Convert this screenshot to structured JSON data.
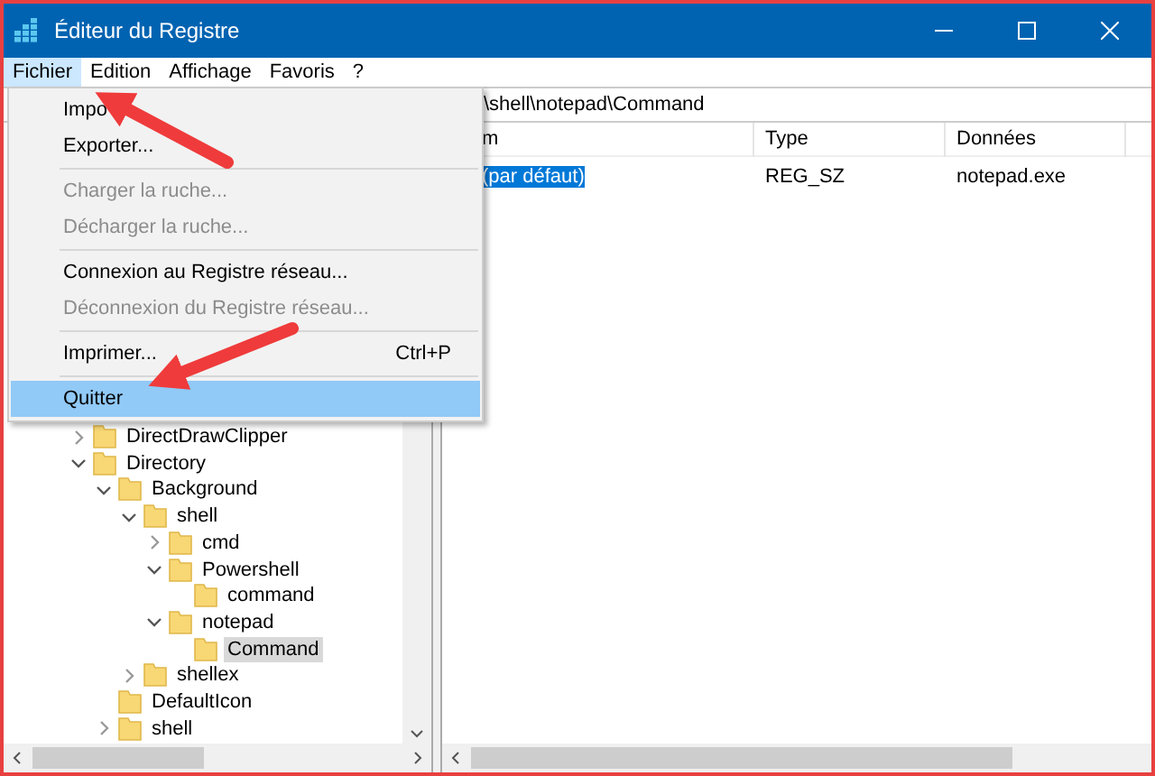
{
  "window": {
    "title": "Éditeur du Registre"
  },
  "menu_bar": [
    {
      "label": "Fichier",
      "selected": true
    },
    {
      "label": "Edition",
      "selected": false
    },
    {
      "label": "Affichage",
      "selected": false
    },
    {
      "label": "Favoris",
      "selected": false
    },
    {
      "label": "?",
      "selected": false
    }
  ],
  "file_menu": [
    {
      "kind": "item",
      "label": "Impo",
      "disabled": false,
      "selected": false
    },
    {
      "kind": "item",
      "label": "Exporter...",
      "disabled": false,
      "selected": false
    },
    {
      "kind": "separator"
    },
    {
      "kind": "item",
      "label": "Charger la ruche...",
      "disabled": true,
      "selected": false
    },
    {
      "kind": "item",
      "label": "Décharger la ruche...",
      "disabled": true,
      "selected": false
    },
    {
      "kind": "separator"
    },
    {
      "kind": "item",
      "label": "Connexion au Registre réseau...",
      "disabled": false,
      "selected": false
    },
    {
      "kind": "item",
      "label": "Déconnexion du Registre réseau...",
      "disabled": true,
      "selected": false
    },
    {
      "kind": "separator"
    },
    {
      "kind": "item",
      "label": "Imprimer...",
      "shortcut": "Ctrl+P",
      "disabled": false,
      "selected": false
    },
    {
      "kind": "separator"
    },
    {
      "kind": "item",
      "label": "Quitter",
      "disabled": false,
      "selected": true
    }
  ],
  "address_bar": {
    "value": "\\shell\\notepad\\Command"
  },
  "tree": [
    {
      "label": "DirectDrawClipper",
      "expanded": false,
      "selected": false
    },
    {
      "label": "Directory",
      "expanded": true,
      "selected": false,
      "children": [
        {
          "label": "Background",
          "expanded": true,
          "selected": false,
          "children": [
            {
              "label": "shell",
              "expanded": true,
              "selected": false,
              "children": [
                {
                  "label": "cmd",
                  "expanded": false,
                  "selected": false
                },
                {
                  "label": "Powershell",
                  "expanded": true,
                  "selected": false,
                  "children": [
                    {
                      "label": "command",
                      "selected": false
                    }
                  ]
                },
                {
                  "label": "notepad",
                  "expanded": true,
                  "selected": false,
                  "children": [
                    {
                      "label": "Command",
                      "selected": true
                    }
                  ]
                }
              ]
            },
            {
              "label": "shellex",
              "expanded": false,
              "selected": false
            }
          ]
        },
        {
          "label": "DefaultIcon",
          "selected": false
        },
        {
          "label": "shell",
          "expanded": false,
          "selected": false
        }
      ]
    }
  ],
  "values_table": {
    "columns": [
      "m",
      "Type",
      "Données"
    ],
    "rows": [
      {
        "cells": [
          "(par défaut)",
          "REG_SZ",
          "notepad.exe"
        ],
        "selected": true
      }
    ]
  }
}
